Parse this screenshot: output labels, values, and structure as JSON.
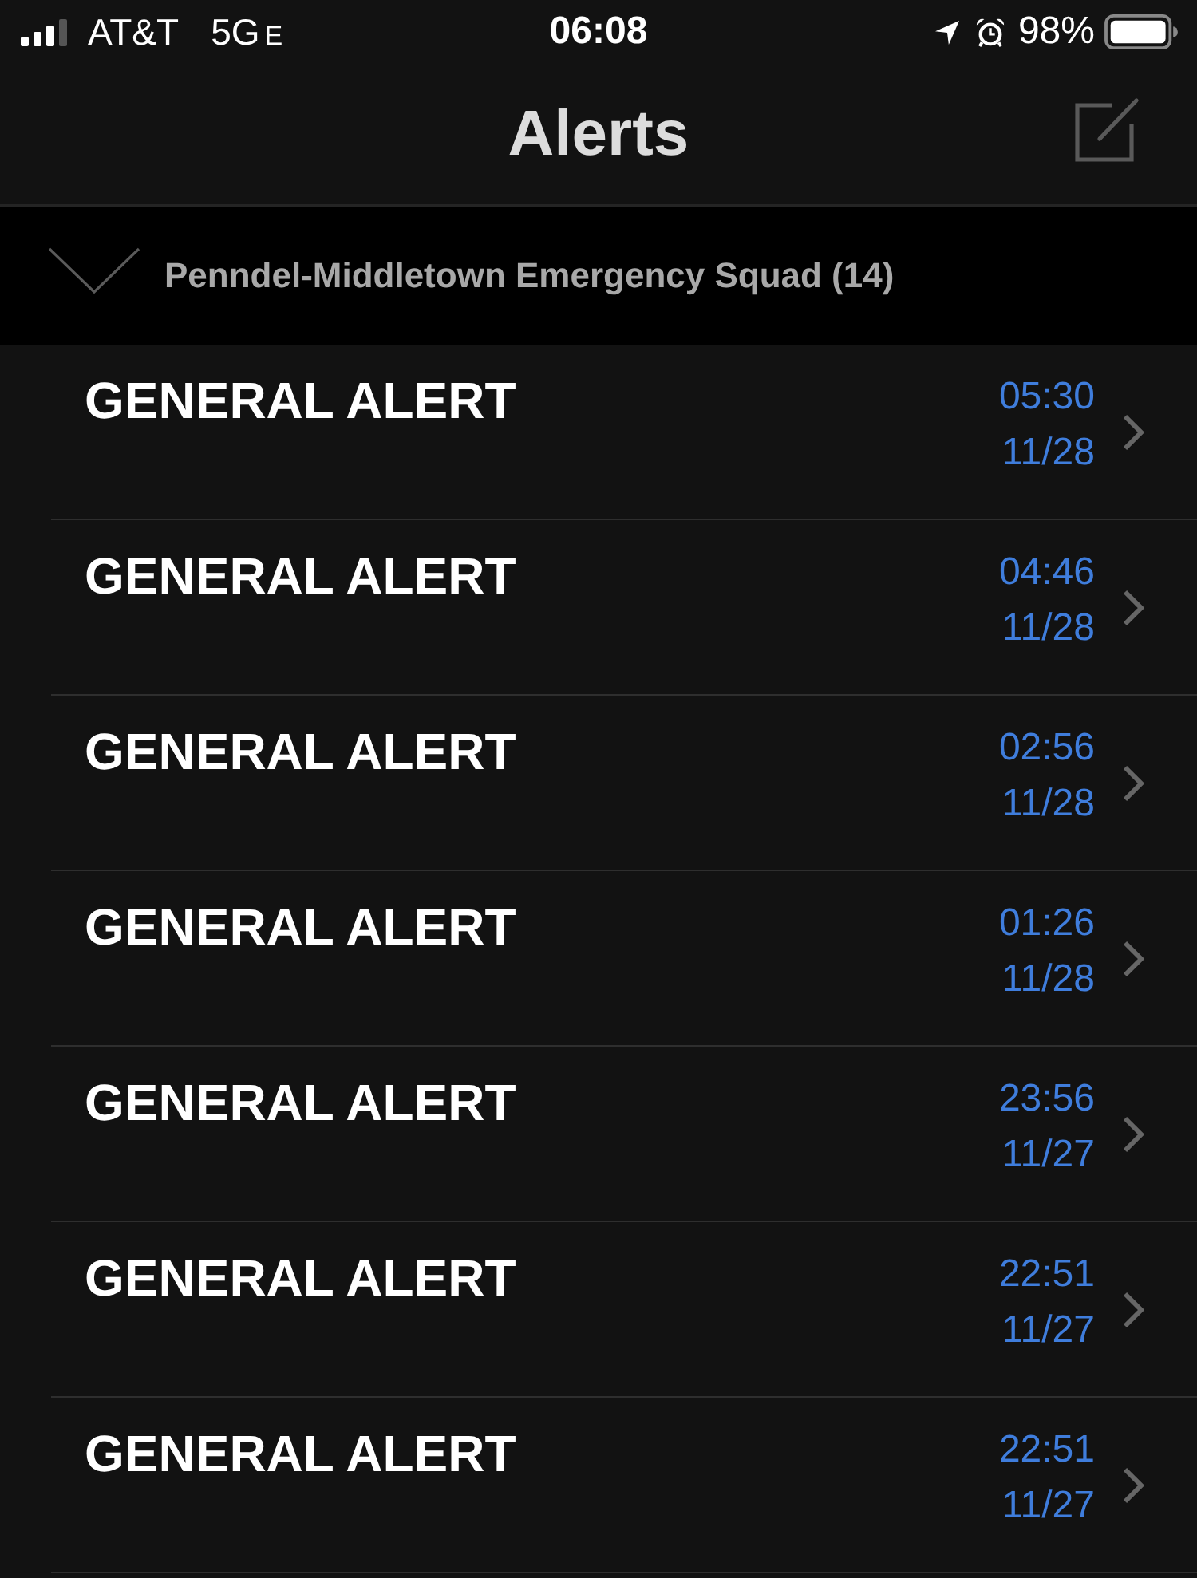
{
  "status_bar": {
    "carrier": "AT&T",
    "network": "5G",
    "network_suffix": "E",
    "time": "06:08",
    "battery": "98%"
  },
  "nav_bar": {
    "title": "Alerts"
  },
  "group": {
    "title": "Penndel-Middletown Emergency Squad (14)",
    "expanded": true
  },
  "alerts": [
    {
      "title": "GENERAL ALERT",
      "time": "05:30",
      "date": "11/28"
    },
    {
      "title": "GENERAL ALERT",
      "time": "04:46",
      "date": "11/28"
    },
    {
      "title": "GENERAL ALERT",
      "time": "02:56",
      "date": "11/28"
    },
    {
      "title": "GENERAL ALERT",
      "time": "01:26",
      "date": "11/28"
    },
    {
      "title": "GENERAL ALERT",
      "time": "23:56",
      "date": "11/27"
    },
    {
      "title": "GENERAL ALERT",
      "time": "22:51",
      "date": "11/27"
    },
    {
      "title": "GENERAL ALERT",
      "time": "22:51",
      "date": "11/27"
    }
  ]
}
